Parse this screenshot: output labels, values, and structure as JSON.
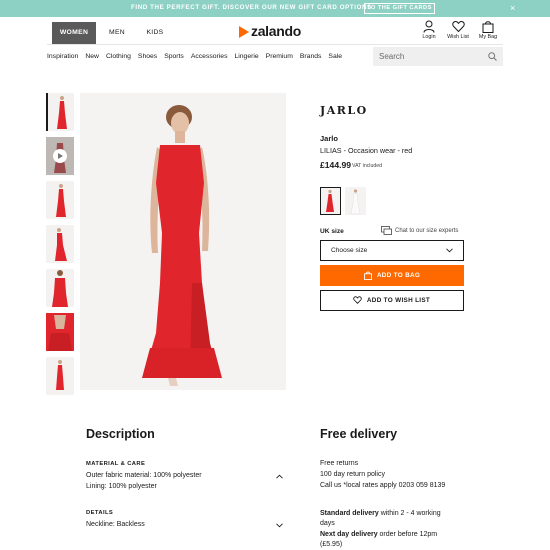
{
  "promo": {
    "text": "FIND THE PERFECT GIFT. DISCOVER OUR NEW GIFT CARD OPTIONS",
    "button": "TO THE GIFT CARDS",
    "close": "×",
    "background": "#8dd0c4"
  },
  "header": {
    "tabs": [
      "WOMEN",
      "MEN",
      "KIDS"
    ],
    "logo": "zalando",
    "utilities": [
      {
        "label": "Login",
        "icon": "user-icon"
      },
      {
        "label": "Wish List",
        "icon": "heart-icon"
      },
      {
        "label": "My Bag",
        "icon": "bag-icon"
      }
    ]
  },
  "nav": {
    "items": [
      "Inspiration",
      "New",
      "Clothing",
      "Shoes",
      "Sports",
      "Accessories",
      "Lingerie",
      "Premium",
      "Brands",
      "Sale"
    ],
    "search_placeholder": "Search"
  },
  "product": {
    "brand_logo": "JARLO",
    "brand": "Jarlo",
    "name": "LILIAS - Occasion wear - red",
    "price": "£144.99",
    "vat": "VAT included",
    "size_label": "UK size",
    "size_chat": "Chat to our size experts",
    "size_select": "Choose size",
    "add_to_bag": "ADD TO BAG",
    "add_to_wishlist": "ADD TO WISH LIST",
    "accent": "#ff6900",
    "dress_color": "#e0262c"
  },
  "description": {
    "title": "Description",
    "material_head": "MATERIAL & CARE",
    "material_lines": [
      "Outer fabric material: 100% polyester",
      "Lining: 100% polyester"
    ],
    "details_head": "DETAILS",
    "details_lines": [
      "Neckline: Backless"
    ]
  },
  "delivery": {
    "title": "Free delivery",
    "lines": [
      "Free returns",
      "100 day return policy",
      "Call us *local rates apply 0203 059 8139"
    ],
    "standard_bold": "Standard delivery",
    "standard_rest": " within 2 - 4 working",
    "standard_line2": "days",
    "nextday_bold": "Next day delivery",
    "nextday_rest": " order before 12pm",
    "nextday_line2": "(£5.95)"
  }
}
